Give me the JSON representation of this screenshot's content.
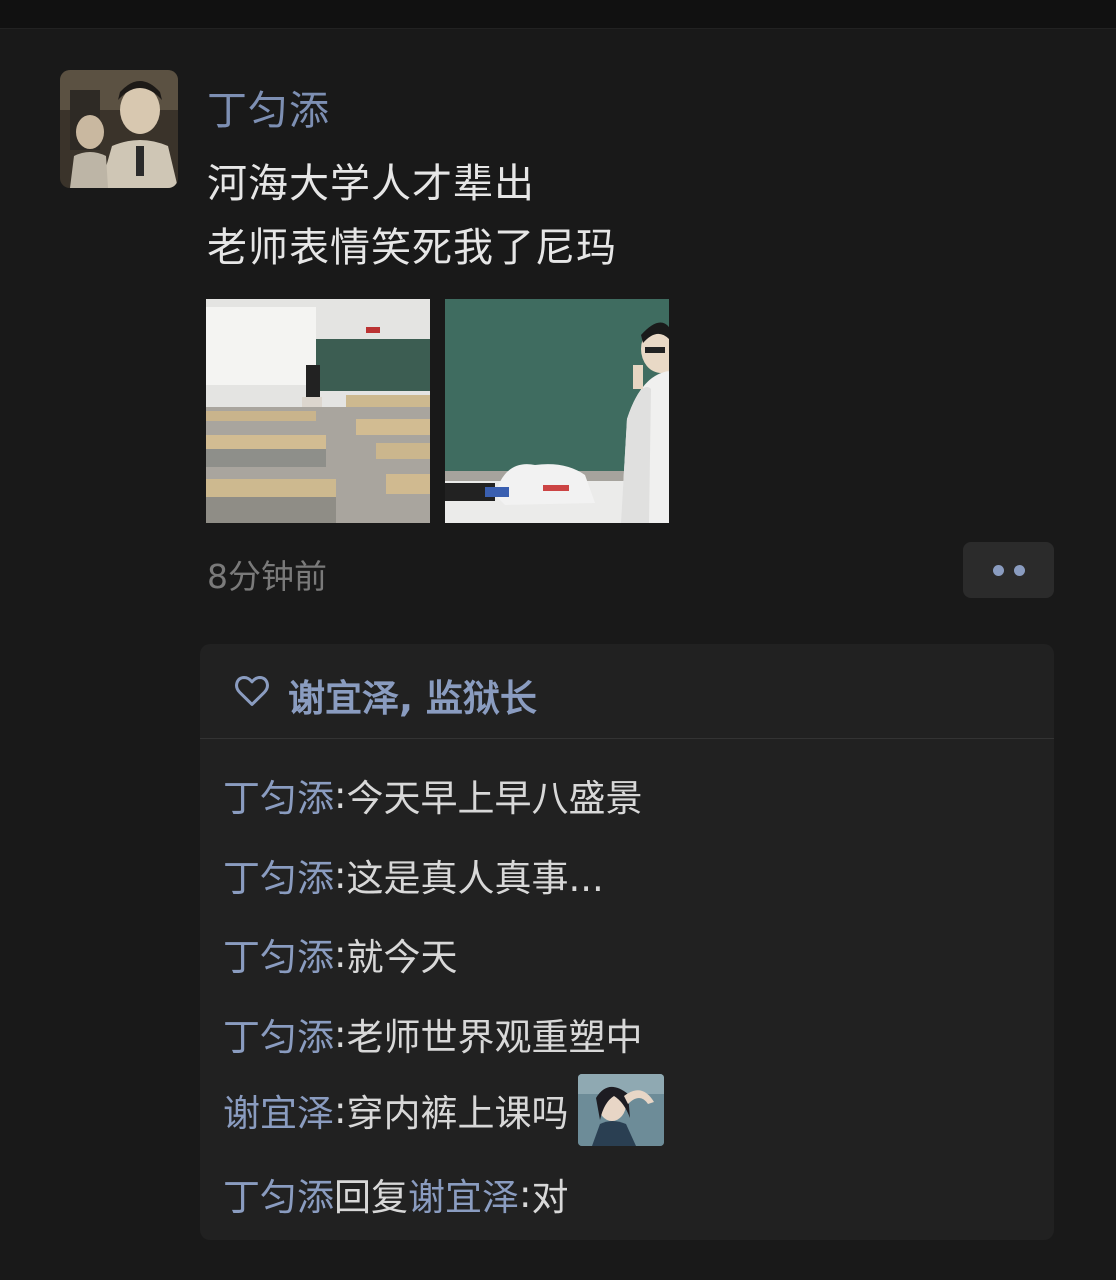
{
  "post": {
    "author": "丁匀添",
    "text_lines": [
      "河海大学人才辈出",
      "老师表情笑死我了尼玛"
    ],
    "time": "8分钟前"
  },
  "likes": {
    "names": "谢宜泽, 监狱长"
  },
  "comments": [
    {
      "author": "丁匀添",
      "sep": ": ",
      "text": "今天早上早八盛景"
    },
    {
      "author": "丁匀添",
      "sep": ": ",
      "text": "这是真人真事..."
    },
    {
      "author": "丁匀添",
      "sep": ": ",
      "text": "就今天"
    },
    {
      "author": "丁匀添",
      "sep": ": ",
      "text": "老师世界观重塑中"
    },
    {
      "author": "谢宜泽",
      "sep": ": ",
      "text": "穿内裤上课吗"
    },
    {
      "author": "丁匀添",
      "reply": "回复",
      "target": "谢宜泽",
      "sep": ": ",
      "text": "对"
    }
  ],
  "icons": {
    "like": "heart-outline-icon",
    "more": "more-dots-icon"
  },
  "colors": {
    "background": "#191919",
    "link_blue": "#7d8fb3",
    "panel": "#212121"
  }
}
